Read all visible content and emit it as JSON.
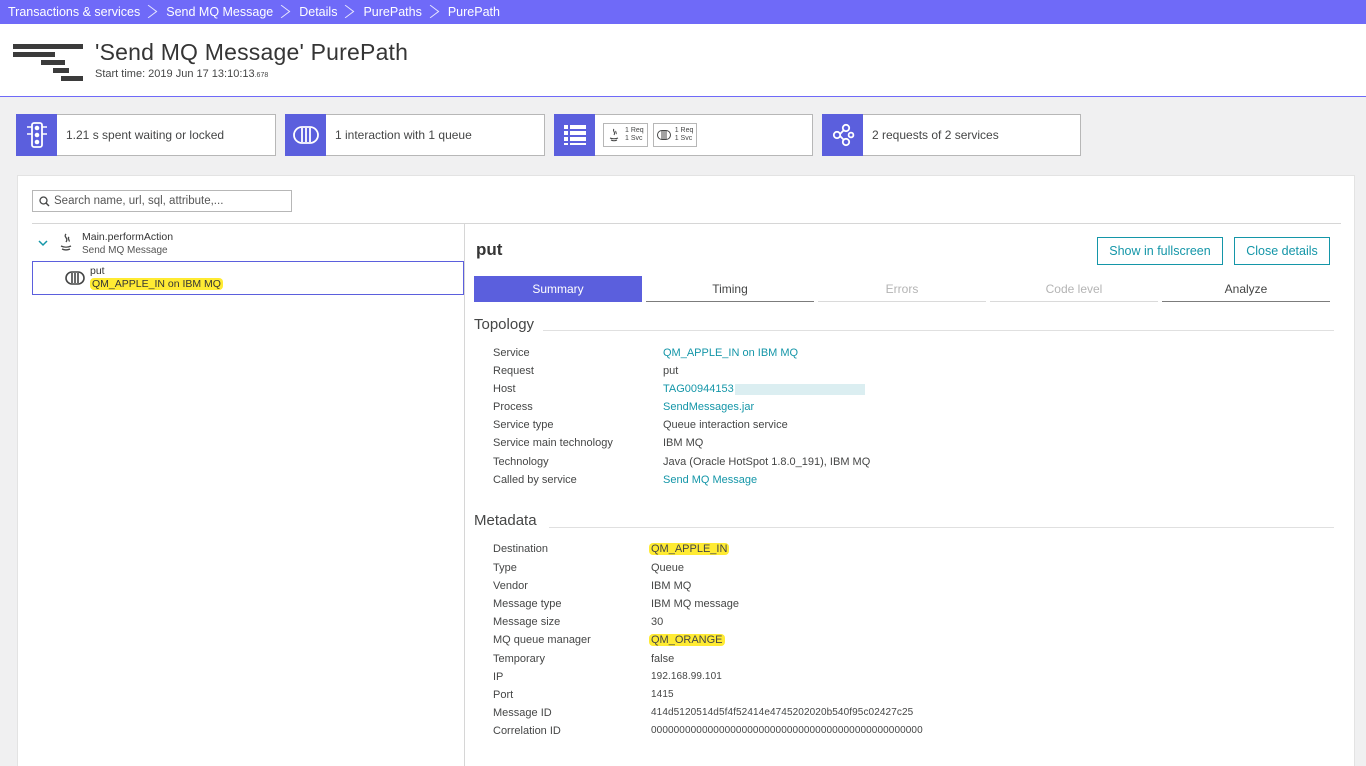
{
  "breadcrumb": [
    "Transactions & services",
    "Send MQ Message",
    "Details",
    "PurePaths",
    "PurePath"
  ],
  "header": {
    "title": "'Send MQ Message' PurePath",
    "start_time_label": "Start time: 2019 Jun 17 13:10:13",
    "start_time_ms": ".678"
  },
  "cards": {
    "waiting": "1.21 s spent waiting or locked",
    "queue": "1 interaction with 1 queue",
    "mini1": {
      "req": "1 Req",
      "svc": "1 Svc"
    },
    "mini2": {
      "req": "1 Req",
      "svc": "1 Svc"
    },
    "services": "2 requests of 2 services"
  },
  "search": {
    "placeholder": "Search name, url, sql, attribute,..."
  },
  "tree": {
    "root": {
      "name": "Main.performAction",
      "sub": "Send MQ Message"
    },
    "node": {
      "name": "put",
      "sub": "QM_APPLE_IN on IBM MQ"
    }
  },
  "details": {
    "title": "put",
    "fullscreen_btn": "Show in fullscreen",
    "close_btn": "Close details",
    "tabs": [
      "Summary",
      "Timing",
      "Errors",
      "Code level",
      "Analyze"
    ]
  },
  "topology": {
    "title": "Topology",
    "rows": [
      {
        "k": "Service",
        "v": "QM_APPLE_IN on IBM MQ"
      },
      {
        "k": "Request",
        "v": "put"
      },
      {
        "k": "Host",
        "v": "TAG00944153"
      },
      {
        "k": "Process",
        "v": "SendMessages.jar"
      },
      {
        "k": "Service type",
        "v": "Queue interaction service"
      },
      {
        "k": "Service main technology",
        "v": "IBM MQ"
      },
      {
        "k": "Technology",
        "v": "Java (Oracle HotSpot 1.8.0_191), IBM MQ"
      },
      {
        "k": "Called by service",
        "v": "Send MQ Message"
      }
    ]
  },
  "metadata": {
    "title": "Metadata",
    "rows": [
      {
        "k": "Destination",
        "v": "QM_APPLE_IN"
      },
      {
        "k": "Type",
        "v": "Queue"
      },
      {
        "k": "Vendor",
        "v": "IBM MQ"
      },
      {
        "k": "Message type",
        "v": "IBM MQ message"
      },
      {
        "k": "Message size",
        "v": "30"
      },
      {
        "k": "MQ queue manager",
        "v": "QM_ORANGE"
      },
      {
        "k": "Temporary",
        "v": "false"
      },
      {
        "k": "IP",
        "v": "192.168.99.101"
      },
      {
        "k": "Port",
        "v": "1415"
      },
      {
        "k": "Message ID",
        "v": "414d5120514d5f4f52414e4745202020b540f95c02427c25"
      },
      {
        "k": "Correlation ID",
        "v": "000000000000000000000000000000000000000000000000"
      }
    ]
  },
  "colors": {
    "accent": "#6f6af8",
    "icon_bg": "#5b5fdd",
    "link": "#1496a8",
    "highlight": "#ffeb33"
  }
}
